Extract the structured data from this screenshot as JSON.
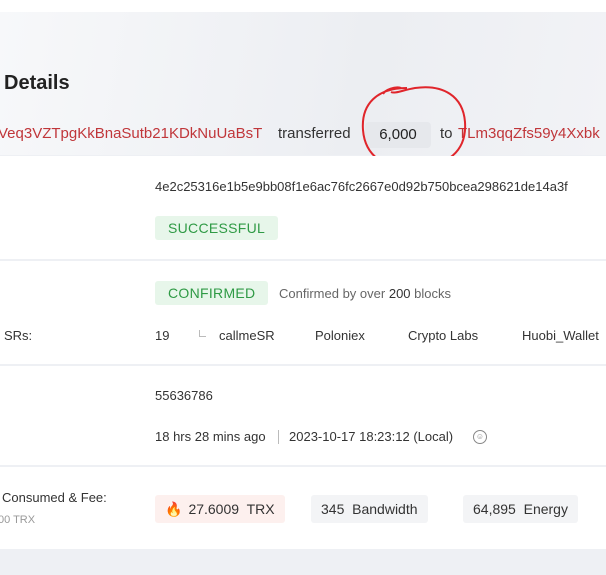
{
  "header": {
    "title": "Details",
    "from_address": "Veq3VZTpgKkBnaSutb21KDkNuUaBsT",
    "transferred_word": "transferred",
    "amount": "6,000",
    "to_word": "to",
    "to_address": "TLm3qqZfs59y4Xxbk"
  },
  "hash_section": {
    "hash": "4e2c25316e1b5e9bb08f1e6ac76fc2667e0d92b750bcea298621de14a3f",
    "result_badge": "SUCCESSFUL"
  },
  "confirm_section": {
    "status_badge": "CONFIRMED",
    "confirmed_prefix": "Confirmed by over",
    "confirmed_count": "200",
    "confirmed_suffix": "blocks",
    "srs_label": "SRs:",
    "srs_count": "19",
    "srs_list": [
      "callmeSR",
      "Poloniex",
      "Crypto Labs",
      "Huobi_Wallet"
    ]
  },
  "block_section": {
    "block_number": "55636786",
    "relative_time": "18 hrs 28 mins ago",
    "timestamp": "2023-10-17 18:23:12 (Local)"
  },
  "fee_section": {
    "label": "Consumed & Fee:",
    "sub_label": "00 TRX",
    "trx_amount": "27.6009",
    "trx_unit": "TRX",
    "bandwidth_amount": "345",
    "bandwidth_unit": "Bandwidth",
    "energy_amount": "64,895",
    "energy_unit": "Energy"
  },
  "colors": {
    "address": "#c0363a",
    "success_text": "#2f9a45",
    "success_bg": "#e7f6ea",
    "annotation_circle": "#e0252b"
  },
  "icons": [
    "fire-icon",
    "clock-face-icon",
    "corner-branch-icon"
  ]
}
